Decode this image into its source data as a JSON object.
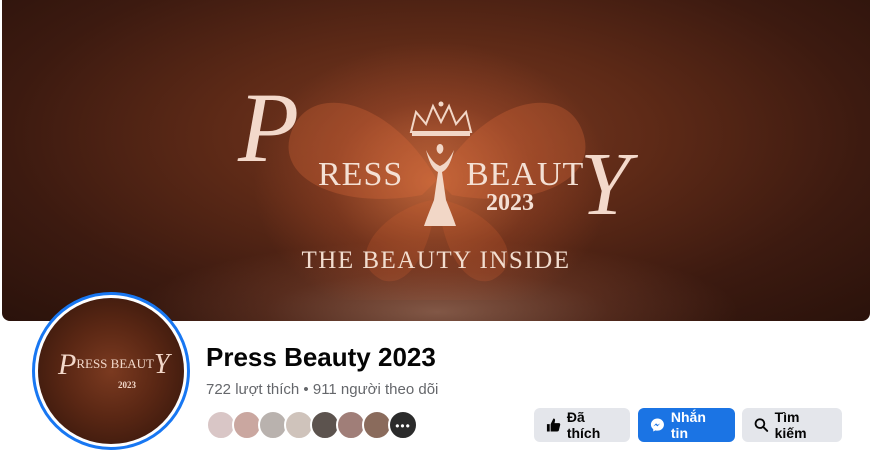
{
  "cover": {
    "logo_p": "P",
    "logo_ress": "RESS",
    "logo_beaut": "BEAUT",
    "logo_y": "Y",
    "logo_year": "2023",
    "tagline": "THE BEAUTY INSIDE"
  },
  "avatar": {
    "logo_p": "P",
    "logo_ress": "RESS",
    "logo_beaut": "BEAUT",
    "logo_y": "Y",
    "logo_year": "2023"
  },
  "page": {
    "name": "Press Beauty 2023",
    "stats": "722 lượt thích • 911 người theo dõi"
  },
  "friends": {
    "more_label": "•••",
    "colors": [
      "#d9c6c6",
      "#caa7a0",
      "#b9b2ae",
      "#cfc3bb",
      "#5c534e",
      "#a07e78",
      "#8a6b5c",
      "#2b2b2b"
    ]
  },
  "actions": {
    "liked_label": "Đã thích",
    "message_label": "Nhắn tin",
    "search_label": "Tìm kiếm"
  },
  "colors": {
    "accent": "#1b74e4",
    "ring": "#1877f2",
    "button_gray": "#e4e6eb"
  },
  "icons": {
    "liked": "thumbs-up-icon",
    "message": "messenger-icon",
    "search": "search-icon"
  }
}
